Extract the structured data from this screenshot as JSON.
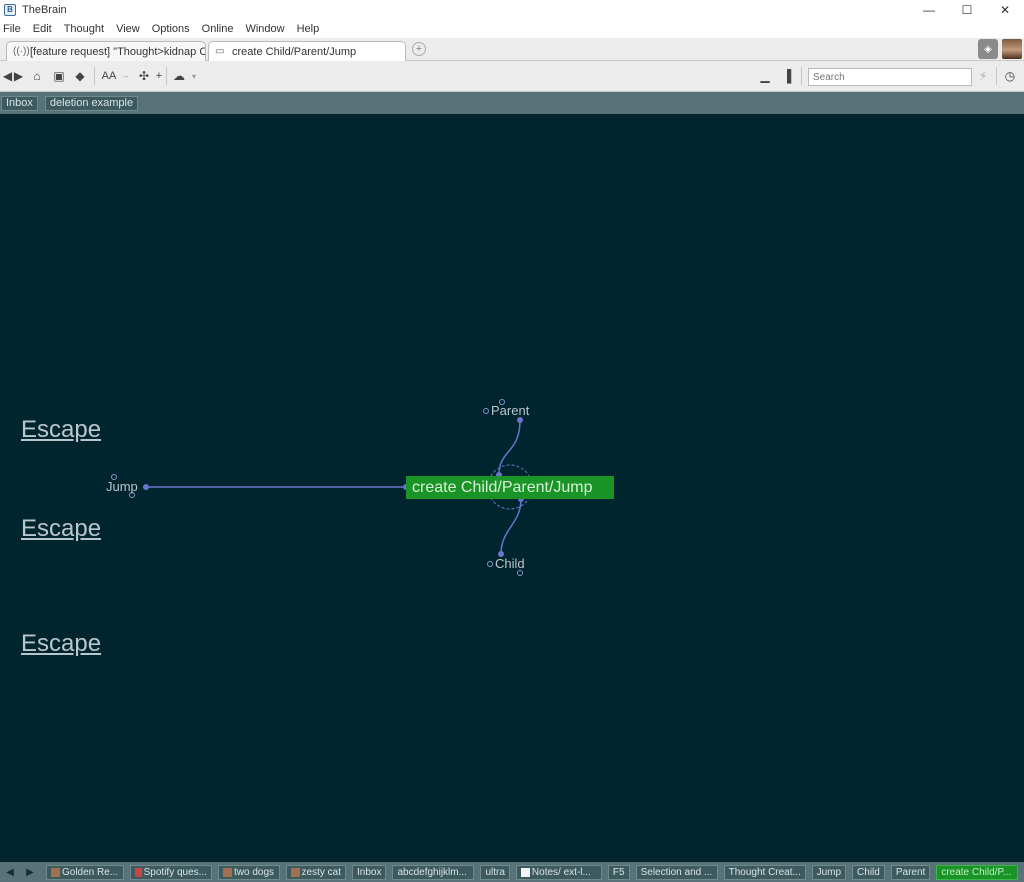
{
  "window": {
    "title": "TheBrain",
    "minimize_glyph": "—",
    "maximize_glyph": "☐",
    "close_glyph": "✕"
  },
  "menu": [
    "File",
    "Edit",
    "Thought",
    "View",
    "Options",
    "Online",
    "Window",
    "Help"
  ],
  "tabs": [
    {
      "label": "[feature request] \"Thought>kidnap C...",
      "icon": "broadcast-icon"
    },
    {
      "label": "create Child/Parent/Jump",
      "icon": "monitor-icon",
      "active": true
    }
  ],
  "toolbar": {
    "search_placeholder": "Search",
    "font_size_label": "AA"
  },
  "pins": [
    "Inbox",
    "deletion example"
  ],
  "plex": {
    "active_thought": "create Child/Parent/Jump",
    "parent": "Parent",
    "child": "Child",
    "jump": "Jump",
    "escape_links": [
      "Escape",
      "Escape",
      "Escape"
    ]
  },
  "history": [
    {
      "label": "Golden Re...",
      "thumb": "photo"
    },
    {
      "label": "Spotify ques...",
      "thumb": "photo"
    },
    {
      "label": "two dogs",
      "thumb": "photo"
    },
    {
      "label": "zesty cat",
      "thumb": "photo"
    },
    {
      "label": "Inbox"
    },
    {
      "label": "abcdefghijklm..."
    },
    {
      "label": "ultra"
    },
    {
      "label": "Notes/ ext-l...",
      "thumb": "white"
    },
    {
      "label": "F5"
    },
    {
      "label": "Selection and ..."
    },
    {
      "label": "Thought Creat..."
    },
    {
      "label": "Jump"
    },
    {
      "label": "Child"
    },
    {
      "label": "Parent"
    },
    {
      "label": "create Child/P...",
      "current": true
    }
  ],
  "colors": {
    "canvas_bg": "#00252f",
    "pinbar_bg": "#587377",
    "active_thought_bg": "#1a9426",
    "link_line": "#6a74cc"
  }
}
